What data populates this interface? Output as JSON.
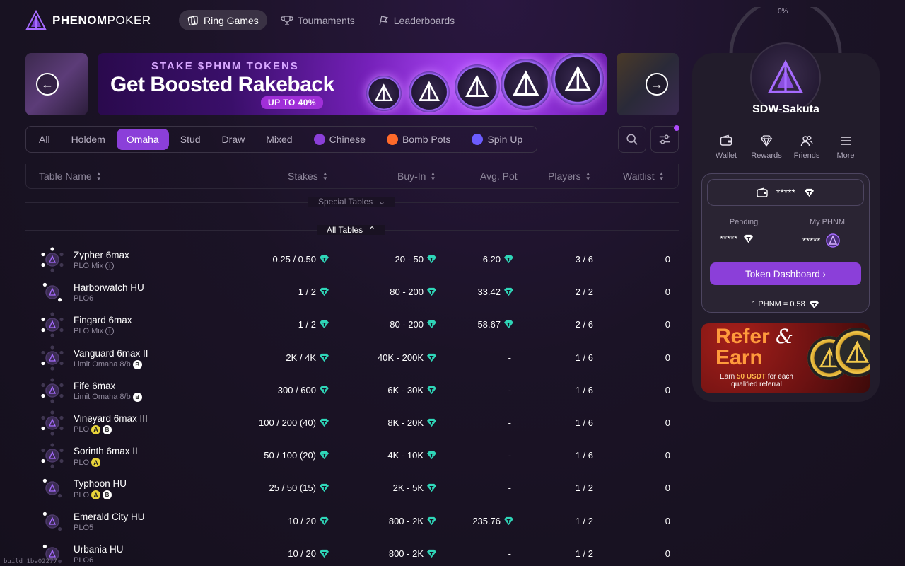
{
  "brand": {
    "name_bold": "PHENOM",
    "name_light": "POKER"
  },
  "nav": [
    {
      "label": "Ring Games",
      "active": true,
      "icon": "cards-icon"
    },
    {
      "label": "Tournaments",
      "active": false,
      "icon": "trophy-icon"
    },
    {
      "label": "Leaderboards",
      "active": false,
      "icon": "flag-icon"
    }
  ],
  "banner": {
    "kicker": "STAKE $PHNM TOKENS",
    "title": "Get Boosted Rakeback",
    "pill": "UP TO 40%"
  },
  "filters": [
    {
      "label": "All",
      "active": false
    },
    {
      "label": "Holdem",
      "active": false
    },
    {
      "label": "Omaha",
      "active": true
    },
    {
      "label": "Stud",
      "active": false
    },
    {
      "label": "Draw",
      "active": false
    },
    {
      "label": "Mixed",
      "active": false
    },
    {
      "label": "Chinese",
      "active": false,
      "icon": "chinese-icon",
      "icon_color": "#8b3fd9"
    },
    {
      "label": "Bomb Pots",
      "active": false,
      "icon": "bomb-icon",
      "icon_color": "#ff6a2a"
    },
    {
      "label": "Spin Up",
      "active": false,
      "icon": "spin-icon",
      "icon_color": "#6c5cff"
    }
  ],
  "columns": {
    "name": "Table Name",
    "stakes": "Stakes",
    "buyin": "Buy-In",
    "pot": "Avg. Pot",
    "players": "Players",
    "waitlist": "Waitlist"
  },
  "sections": {
    "special": "Special Tables",
    "all": "All Tables"
  },
  "tables": [
    {
      "name": "Zypher 6max",
      "game": "PLO Mix",
      "badges": [
        "info"
      ],
      "stakes": "0.25 / 0.50",
      "buyin": "20 - 50",
      "pot": "6.20",
      "players": "3 / 6",
      "waitlist": "0",
      "seats": 6,
      "occupied": 3
    },
    {
      "name": "Harborwatch HU",
      "game": "PLO6",
      "badges": [],
      "stakes": "1 / 2",
      "buyin": "80 - 200",
      "pot": "33.42",
      "players": "2 / 2",
      "waitlist": "0",
      "seats": 2,
      "occupied": 2
    },
    {
      "name": "Fingard 6max",
      "game": "PLO Mix",
      "badges": [
        "info"
      ],
      "stakes": "1 / 2",
      "buyin": "80 - 200",
      "pot": "58.67",
      "players": "2 / 6",
      "waitlist": "0",
      "seats": 6,
      "occupied": 2
    },
    {
      "name": "Vanguard 6max II",
      "game": "Limit Omaha 8/b",
      "badges": [
        "b"
      ],
      "stakes": "2K / 4K",
      "buyin": "40K - 200K",
      "pot": "-",
      "players": "1 / 6",
      "waitlist": "0",
      "seats": 6,
      "occupied": 1
    },
    {
      "name": "Fife 6max",
      "game": "Limit Omaha 8/b",
      "badges": [
        "b"
      ],
      "stakes": "300 / 600",
      "buyin": "6K - 30K",
      "pot": "-",
      "players": "1 / 6",
      "waitlist": "0",
      "seats": 6,
      "occupied": 1
    },
    {
      "name": "Vineyard 6max III",
      "game": "PLO",
      "badges": [
        "a",
        "b"
      ],
      "stakes": "100 / 200 (40)",
      "buyin": "8K - 20K",
      "pot": "-",
      "players": "1 / 6",
      "waitlist": "0",
      "seats": 6,
      "occupied": 1
    },
    {
      "name": "Sorinth 6max II",
      "game": "PLO",
      "badges": [
        "a"
      ],
      "stakes": "50 / 100 (20)",
      "buyin": "4K - 10K",
      "pot": "-",
      "players": "1 / 6",
      "waitlist": "0",
      "seats": 6,
      "occupied": 1
    },
    {
      "name": "Typhoon HU",
      "game": "PLO",
      "badges": [
        "a",
        "b"
      ],
      "stakes": "25 / 50 (15)",
      "buyin": "2K - 5K",
      "pot": "-",
      "players": "1 / 2",
      "waitlist": "0",
      "seats": 2,
      "occupied": 1
    },
    {
      "name": "Emerald City HU",
      "game": "PLO5",
      "badges": [],
      "stakes": "10 / 20",
      "buyin": "800 - 2K",
      "pot": "235.76",
      "players": "1 / 2",
      "waitlist": "0",
      "seats": 2,
      "occupied": 1
    },
    {
      "name": "Urbania HU",
      "game": "PLO6",
      "badges": [],
      "stakes": "10 / 20",
      "buyin": "800 - 2K",
      "pot": "-",
      "players": "1 / 2",
      "waitlist": "0",
      "seats": 2,
      "occupied": 1
    }
  ],
  "profile": {
    "progress_label": "0%",
    "progress": 0,
    "username": "SDW-Sakuta",
    "quick_actions": [
      {
        "label": "Wallet",
        "icon": "wallet-icon"
      },
      {
        "label": "Rewards",
        "icon": "diamond-icon"
      },
      {
        "label": "Friends",
        "icon": "friends-icon"
      },
      {
        "label": "More",
        "icon": "menu-icon"
      }
    ],
    "balance": "*****",
    "pending_label": "Pending",
    "pending_value": "*****",
    "myphnm_label": "My PHNM",
    "myphnm_value": "*****",
    "token_button": "Token Dashboard ›",
    "rate": "1 PHNM = 0.58"
  },
  "refer": {
    "title1": "Refer",
    "amp": "&",
    "title2": "Earn",
    "sub_pre": "Earn",
    "sub_amount": "50 USDT",
    "sub_post": "for each qualified referral"
  },
  "build": "build 1be02277",
  "colors": {
    "accent": "#8b3fd9",
    "gem": "#2fd6b8",
    "bg": "#1b1326"
  }
}
